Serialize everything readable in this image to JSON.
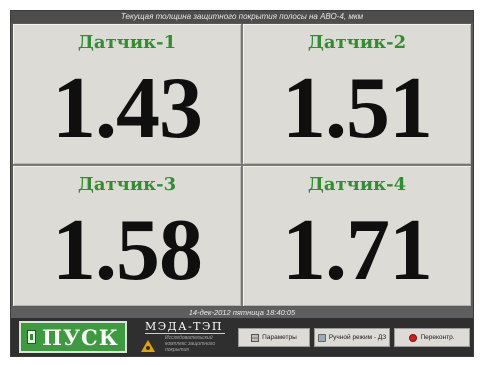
{
  "header": {
    "title": "Текущая толщина защитного покрытия полосы на АВО-4, мкм"
  },
  "sensors": [
    {
      "label": "Датчик-1",
      "value": "1.43"
    },
    {
      "label": "Датчик-2",
      "value": "1.51"
    },
    {
      "label": "Датчик-3",
      "value": "1.58"
    },
    {
      "label": "Датчик-4",
      "value": "1.71"
    }
  ],
  "status": {
    "datetime": "14-дек-2012 пятница 18:40:05"
  },
  "controls": {
    "start_label": "ПУСК",
    "params_label": "Параметры",
    "manual_label": "Ручной режим - ДЗ",
    "check_label": "Переконтр."
  },
  "logo": {
    "title": "МЭДА-ТЭП",
    "subtitle": "Исследовательский комплекс защитного покрытия"
  },
  "icons": {
    "start": "power-icon",
    "params": "settings-icon",
    "manual": "manual-mode-icon",
    "check": "recheck-icon",
    "logo": "hazard-icon"
  },
  "colors": {
    "sensor_label": "#2f8f2f",
    "start_button": "#3c9b3c",
    "panel_bg": "#dcdbd6"
  }
}
